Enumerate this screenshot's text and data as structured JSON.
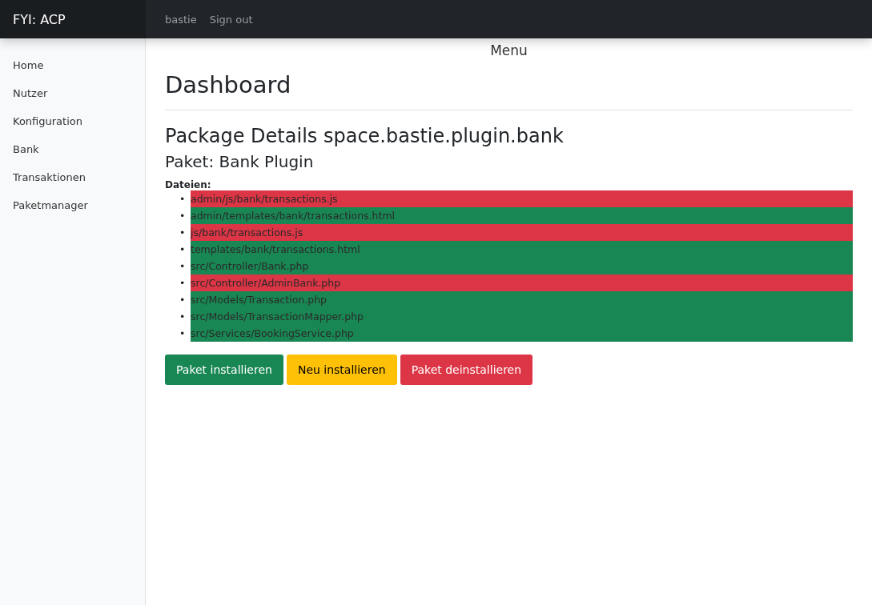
{
  "navbar": {
    "brand": "FYI: ACP",
    "links": [
      "bastie",
      "Sign out"
    ]
  },
  "sidebar": {
    "items": [
      "Home",
      "Nutzer",
      "Konfiguration",
      "Bank",
      "Transaktionen",
      "Paketmanager"
    ]
  },
  "menu_title": "Menu",
  "page_title": "Dashboard",
  "package_heading": "Package Details space.bastie.plugin.bank",
  "package_name": "Paket: Bank Plugin",
  "files_label": "Dateien:",
  "files": [
    {
      "bullet": "•",
      "path": "admin/js/bank/transactions.js",
      "color": "#dc3545"
    },
    {
      "bullet": "•",
      "path": "admin/templates/bank/transactions.html",
      "color": "#198754"
    },
    {
      "bullet": "•",
      "path": "js/bank/transactions.js",
      "color": "#dc3545"
    },
    {
      "bullet": "•",
      "path": "templates/bank/transactions.html",
      "color": "#198754"
    },
    {
      "bullet": "•",
      "path": "src/Controller/Bank.php",
      "color": "#198754"
    },
    {
      "bullet": "•",
      "path": "src/Controller/AdminBank.php",
      "color": "#dc3545"
    },
    {
      "bullet": "•",
      "path": "src/Models/Transaction.php",
      "color": "#198754"
    },
    {
      "bullet": "•",
      "path": "src/Models/TransactionMapper.php",
      "color": "#198754"
    },
    {
      "bullet": "•",
      "path": "src/Services/BookingService.php",
      "color": "#198754"
    }
  ],
  "buttons": [
    {
      "label": "Paket installieren",
      "kind": "success"
    },
    {
      "label": "Neu installieren",
      "kind": "warning"
    },
    {
      "label": "Paket deinstallieren",
      "kind": "danger"
    }
  ]
}
